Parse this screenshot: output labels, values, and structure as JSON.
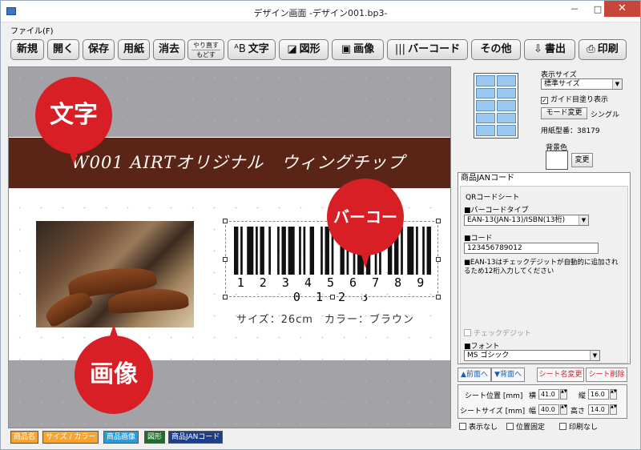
{
  "window": {
    "title": "デザイン画面 -デザイン001.bp3-",
    "min": "－",
    "max": "□",
    "close": "✕"
  },
  "menu": {
    "file": "ファイル(F)"
  },
  "toolbar": {
    "new": "新規",
    "open": "開く",
    "save": "保存",
    "paper": "用紙",
    "erase": "消去",
    "redo": "やり直す",
    "undo": "もどす",
    "text": "文字",
    "shape": "図形",
    "image": "画像",
    "barcode": "バーコード",
    "other": "その他",
    "export": "書出",
    "print": "印刷"
  },
  "canvas": {
    "title_text": "W001 AIRTオリジナル　ウィングチップ",
    "barcode_number": "1 2 3 4 5 6 7 8 9 0 1 2 8",
    "size_text": "サイズ：26cm　カラー：ブラウン",
    "badge_text": "文字",
    "badge_image": "画像",
    "badge_barcode": "バーコード"
  },
  "panel": {
    "display_size_label": "表示サイズ",
    "display_size_value": "標準サイズ",
    "guide_fill_label": "ガイド目塗り表示",
    "guide_fill_checked": true,
    "mode_change": "モード変更",
    "mode_single": "シングル",
    "paper_model": "用紙型番：38179",
    "bg_color_label": "背景色",
    "change_label": "変更"
  },
  "property": {
    "header": "商品JANコード",
    "sheet_type": "QRコードシート",
    "barcode_type_label": "■バーコードタイプ",
    "barcode_type_value": "EAN-13(JAN-13)/ISBN(13桁)",
    "code_label": "■コード",
    "code_value": "123456789012",
    "note": "■EAN-13はチェックデジットが自動的に追加されるため12桁入力してください",
    "check_digit": "チェックデジット",
    "font_label": "■フォント",
    "font_value": "MS ゴシック"
  },
  "edit": {
    "front": "▲前面へ",
    "back": "▼背面へ",
    "rename": "シート名変更",
    "delete": "シート削除"
  },
  "position": {
    "pos_label": "シート位置 [mm]",
    "x_label": "横",
    "x_value": "41.0",
    "y_label": "縦",
    "y_value": "16.0",
    "size_label": "シートサイズ [mm]",
    "w_label": "幅",
    "w_value": "40.0",
    "h_label": "高さ",
    "h_value": "14.0"
  },
  "options": {
    "hide": "表示なし",
    "lock": "位置固定",
    "noprint": "印刷なし"
  },
  "tabs": [
    {
      "label": "商品名",
      "color": "#f6a531"
    },
    {
      "label": "サイズ / カラー",
      "color": "#f6a531"
    },
    {
      "label": "商品画像",
      "color": "#2d9bd6"
    },
    {
      "label": "図形",
      "color": "#1c6e2a"
    },
    {
      "label": "商品JANコード",
      "color": "#1f3f8a"
    }
  ],
  "colors": {
    "badge": "#d81f26",
    "brown": "#5a2516",
    "canvas_gray": "#a3a3a7"
  }
}
